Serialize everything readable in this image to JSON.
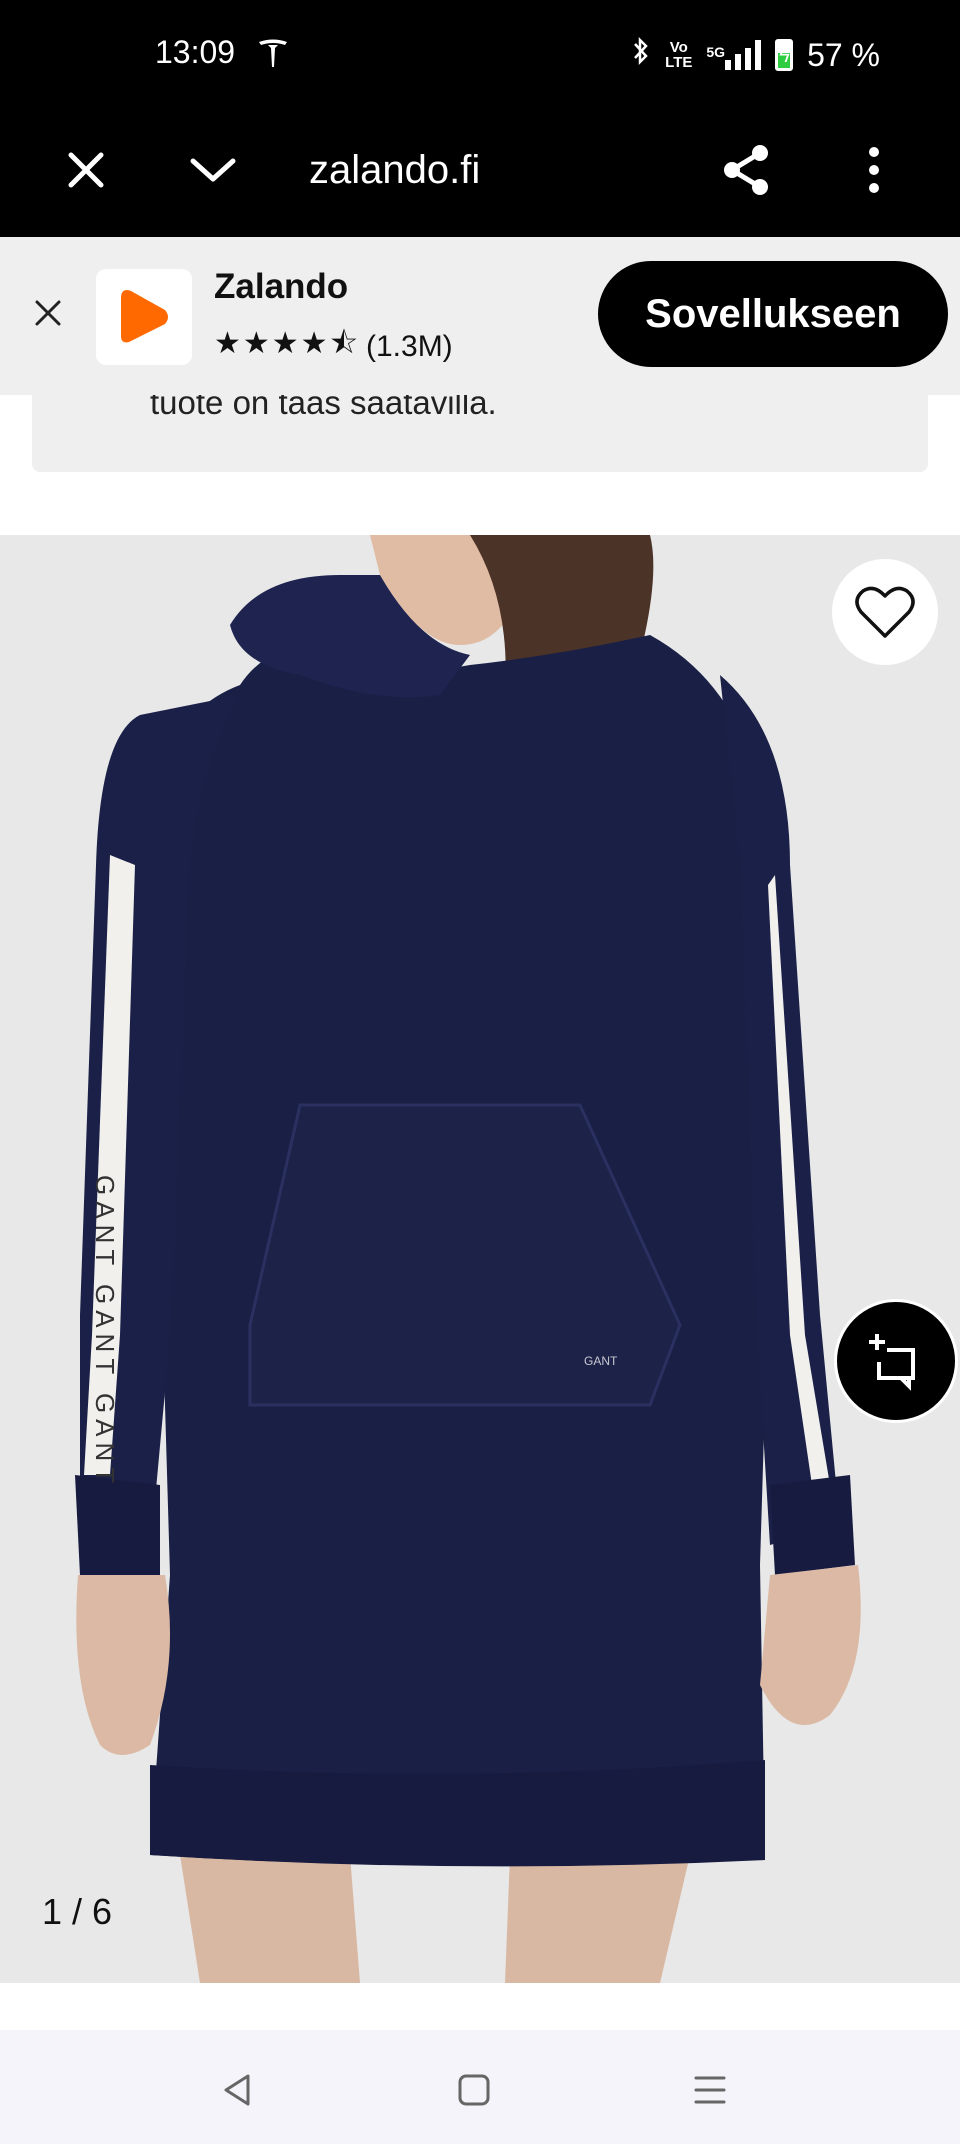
{
  "status_bar": {
    "time": "13:09",
    "network_label": "Vo\nLTE",
    "signal_label": "5G",
    "battery": "57 %",
    "battery_level": 0.57
  },
  "browser": {
    "url": "zalando.fi",
    "icons": [
      "close-icon",
      "chevron-down-icon",
      "share-icon",
      "more-vertical-icon"
    ]
  },
  "app_banner": {
    "app_name": "Zalando",
    "stars": "★★★★⯪",
    "rating_count": "(1.3M)",
    "rating_value": 4.5,
    "open_label": "Sovellukseen",
    "brand_color": "#ff6900"
  },
  "notice": {
    "text": "tuote on taas saatavilla."
  },
  "gallery": {
    "counter": "1 / 6",
    "current_image": 1,
    "total_images": 6,
    "product_logo_text": "GANT",
    "sleeve_text": "GANT GANT GANT"
  },
  "navbar": {
    "icons": [
      "back-triangle-icon",
      "home-square-icon",
      "menu-lines-icon"
    ]
  }
}
